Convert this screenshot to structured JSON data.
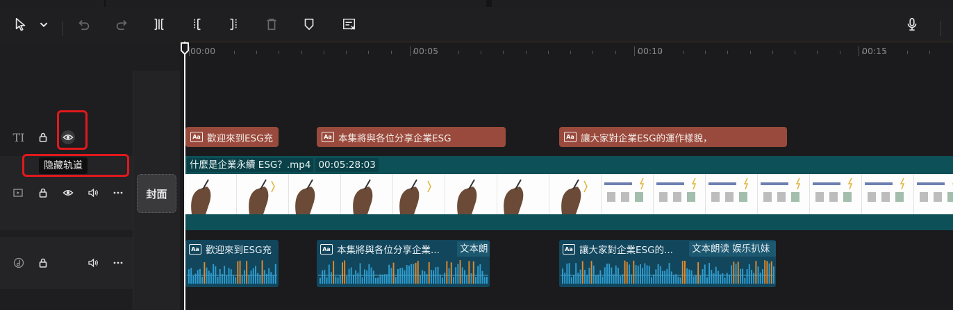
{
  "toolbar": {
    "select_tool": "cursor-icon",
    "items": [
      "cursor-icon",
      "chevron-down-icon",
      "undo-icon",
      "redo-icon",
      "split-icon",
      "split-left-icon",
      "split-right-icon",
      "delete-icon",
      "marker-icon",
      "text-recognize-icon",
      "microphone-icon"
    ]
  },
  "ruler": {
    "labels": [
      "00:00",
      "00:05",
      "00:10",
      "00:15"
    ]
  },
  "tracks": {
    "text": {
      "icon": "text-track-icon",
      "label": "TI"
    },
    "video": {
      "icon": "video-track-icon"
    },
    "audio": {
      "icon": "audio-track-icon"
    }
  },
  "tooltip": "隐藏轨道",
  "cover_label": "封面",
  "text_clips": [
    {
      "label": "歡迎來到ESG充"
    },
    {
      "label": "本集將與各位分享企業ESG"
    },
    {
      "label": "讓大家對企業ESG的運作樣貌，"
    }
  ],
  "video_clip": {
    "name": "什麼是企業永續 ESG？.mp4",
    "duration": "00:05:28:03"
  },
  "audio_clips": [
    {
      "label": "歡迎來到ESG充"
    },
    {
      "label": "本集將與各位分享企業...",
      "tag": "文本朗"
    },
    {
      "label": "讓大家對企業ESG的...",
      "tag": "文本朗读 娱乐扒妹"
    }
  ],
  "colors": {
    "text_clip": "#9a4a3c",
    "video_clip": "#0d5058",
    "audio_clip": "#12465c",
    "highlight": "#e1181c"
  }
}
